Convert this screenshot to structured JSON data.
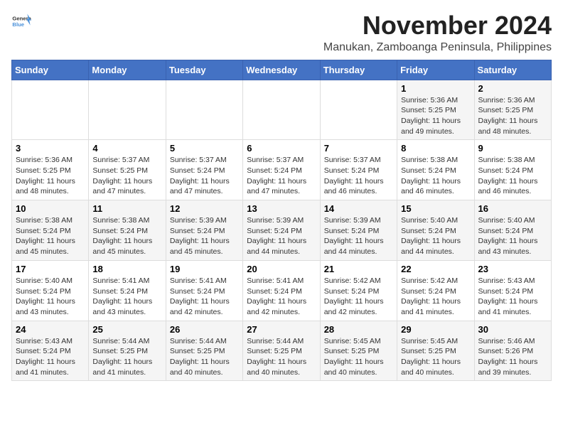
{
  "logo": {
    "text_general": "General",
    "text_blue": "Blue"
  },
  "header": {
    "month_title": "November 2024",
    "location": "Manukan, Zamboanga Peninsula, Philippines"
  },
  "weekdays": [
    "Sunday",
    "Monday",
    "Tuesday",
    "Wednesday",
    "Thursday",
    "Friday",
    "Saturday"
  ],
  "weeks": [
    [
      {
        "day": "",
        "info": ""
      },
      {
        "day": "",
        "info": ""
      },
      {
        "day": "",
        "info": ""
      },
      {
        "day": "",
        "info": ""
      },
      {
        "day": "",
        "info": ""
      },
      {
        "day": "1",
        "info": "Sunrise: 5:36 AM\nSunset: 5:25 PM\nDaylight: 11 hours and 49 minutes."
      },
      {
        "day": "2",
        "info": "Sunrise: 5:36 AM\nSunset: 5:25 PM\nDaylight: 11 hours and 48 minutes."
      }
    ],
    [
      {
        "day": "3",
        "info": "Sunrise: 5:36 AM\nSunset: 5:25 PM\nDaylight: 11 hours and 48 minutes."
      },
      {
        "day": "4",
        "info": "Sunrise: 5:37 AM\nSunset: 5:25 PM\nDaylight: 11 hours and 47 minutes."
      },
      {
        "day": "5",
        "info": "Sunrise: 5:37 AM\nSunset: 5:24 PM\nDaylight: 11 hours and 47 minutes."
      },
      {
        "day": "6",
        "info": "Sunrise: 5:37 AM\nSunset: 5:24 PM\nDaylight: 11 hours and 47 minutes."
      },
      {
        "day": "7",
        "info": "Sunrise: 5:37 AM\nSunset: 5:24 PM\nDaylight: 11 hours and 46 minutes."
      },
      {
        "day": "8",
        "info": "Sunrise: 5:38 AM\nSunset: 5:24 PM\nDaylight: 11 hours and 46 minutes."
      },
      {
        "day": "9",
        "info": "Sunrise: 5:38 AM\nSunset: 5:24 PM\nDaylight: 11 hours and 46 minutes."
      }
    ],
    [
      {
        "day": "10",
        "info": "Sunrise: 5:38 AM\nSunset: 5:24 PM\nDaylight: 11 hours and 45 minutes."
      },
      {
        "day": "11",
        "info": "Sunrise: 5:38 AM\nSunset: 5:24 PM\nDaylight: 11 hours and 45 minutes."
      },
      {
        "day": "12",
        "info": "Sunrise: 5:39 AM\nSunset: 5:24 PM\nDaylight: 11 hours and 45 minutes."
      },
      {
        "day": "13",
        "info": "Sunrise: 5:39 AM\nSunset: 5:24 PM\nDaylight: 11 hours and 44 minutes."
      },
      {
        "day": "14",
        "info": "Sunrise: 5:39 AM\nSunset: 5:24 PM\nDaylight: 11 hours and 44 minutes."
      },
      {
        "day": "15",
        "info": "Sunrise: 5:40 AM\nSunset: 5:24 PM\nDaylight: 11 hours and 44 minutes."
      },
      {
        "day": "16",
        "info": "Sunrise: 5:40 AM\nSunset: 5:24 PM\nDaylight: 11 hours and 43 minutes."
      }
    ],
    [
      {
        "day": "17",
        "info": "Sunrise: 5:40 AM\nSunset: 5:24 PM\nDaylight: 11 hours and 43 minutes."
      },
      {
        "day": "18",
        "info": "Sunrise: 5:41 AM\nSunset: 5:24 PM\nDaylight: 11 hours and 43 minutes."
      },
      {
        "day": "19",
        "info": "Sunrise: 5:41 AM\nSunset: 5:24 PM\nDaylight: 11 hours and 42 minutes."
      },
      {
        "day": "20",
        "info": "Sunrise: 5:41 AM\nSunset: 5:24 PM\nDaylight: 11 hours and 42 minutes."
      },
      {
        "day": "21",
        "info": "Sunrise: 5:42 AM\nSunset: 5:24 PM\nDaylight: 11 hours and 42 minutes."
      },
      {
        "day": "22",
        "info": "Sunrise: 5:42 AM\nSunset: 5:24 PM\nDaylight: 11 hours and 41 minutes."
      },
      {
        "day": "23",
        "info": "Sunrise: 5:43 AM\nSunset: 5:24 PM\nDaylight: 11 hours and 41 minutes."
      }
    ],
    [
      {
        "day": "24",
        "info": "Sunrise: 5:43 AM\nSunset: 5:24 PM\nDaylight: 11 hours and 41 minutes."
      },
      {
        "day": "25",
        "info": "Sunrise: 5:44 AM\nSunset: 5:25 PM\nDaylight: 11 hours and 41 minutes."
      },
      {
        "day": "26",
        "info": "Sunrise: 5:44 AM\nSunset: 5:25 PM\nDaylight: 11 hours and 40 minutes."
      },
      {
        "day": "27",
        "info": "Sunrise: 5:44 AM\nSunset: 5:25 PM\nDaylight: 11 hours and 40 minutes."
      },
      {
        "day": "28",
        "info": "Sunrise: 5:45 AM\nSunset: 5:25 PM\nDaylight: 11 hours and 40 minutes."
      },
      {
        "day": "29",
        "info": "Sunrise: 5:45 AM\nSunset: 5:25 PM\nDaylight: 11 hours and 40 minutes."
      },
      {
        "day": "30",
        "info": "Sunrise: 5:46 AM\nSunset: 5:26 PM\nDaylight: 11 hours and 39 minutes."
      }
    ]
  ]
}
